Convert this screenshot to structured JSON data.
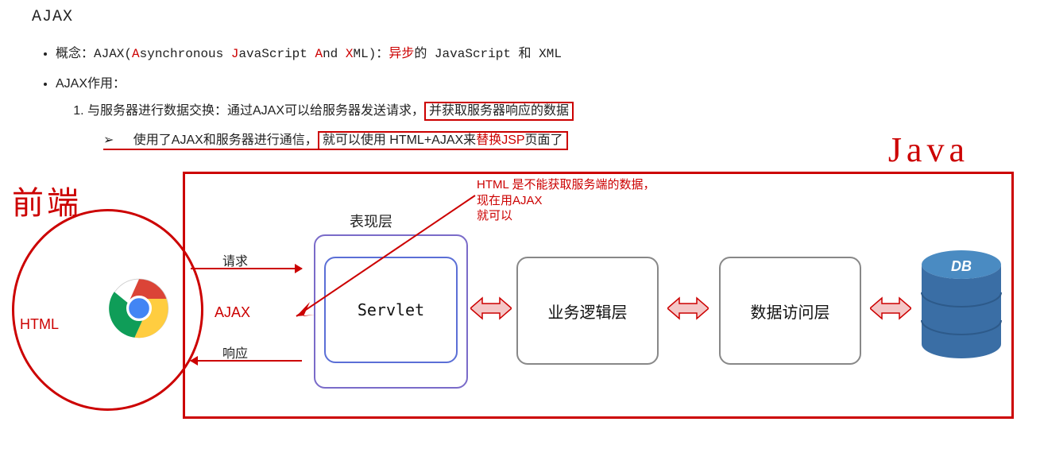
{
  "title": "AJAX",
  "bullets": {
    "concept_prefix": "概念：AJAX(",
    "concept_A": "A",
    "concept_sync": "synchronous ",
    "concept_J": "J",
    "concept_js": "avaScript ",
    "concept_And_A": "A",
    "concept_nd": "nd ",
    "concept_X": "X",
    "concept_ml": "ML)：",
    "concept_async": "异步",
    "concept_tail": "的 JavaScript 和 XML",
    "usage_label": "AJAX作用：",
    "usage1_pre": "与服务器进行数据交换：通过AJAX可以给服务器发送请求，",
    "usage1_boxed": "并获取服务器响应的数据",
    "sub_arrow": "➢",
    "sub_pre": "使用了AJAX和服务器进行通信，",
    "sub_boxed_pre": "就可以使用 HTML+AJAX来",
    "sub_boxed_red": "替换JSP",
    "sub_boxed_tail": "页面了"
  },
  "annotations": {
    "front": "前端",
    "java": "Java",
    "html": "HTML",
    "ajax": "AJAX",
    "request": "请求",
    "response": "响应",
    "note_l1": "HTML 是不能获取服务端的数据，",
    "note_l2": "现在用AJAX",
    "note_l3": "就可以"
  },
  "layers": {
    "presentation": "表现层",
    "servlet": "Servlet",
    "business": "业务逻辑层",
    "dao": "数据访问层",
    "db": "DB"
  },
  "colors": {
    "red": "#cc0000",
    "purple": "#7a6bc9",
    "blue": "#5b6fd6",
    "dbblue": "#3a6ea5"
  }
}
